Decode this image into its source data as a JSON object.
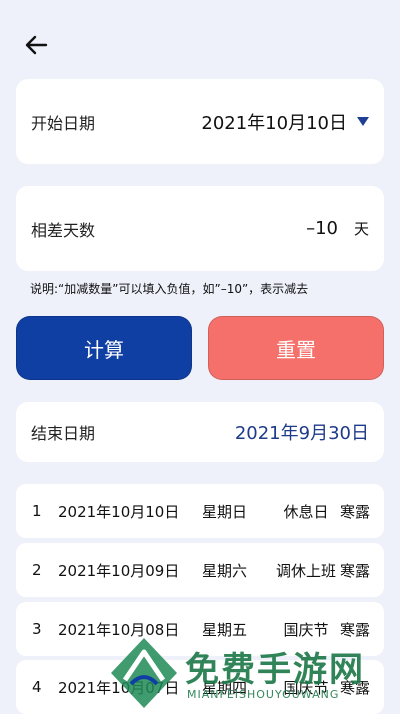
{
  "header": {
    "back_icon": "arrow-left-icon"
  },
  "start": {
    "label": "开始日期",
    "value": "2021年10月10日",
    "dropdown_icon": "triangle-down-icon"
  },
  "difference": {
    "label": "相差天数",
    "value": "–10",
    "unit": "天"
  },
  "note": "说明:“加减数量”可以填入负值，如”–10”，表示减去",
  "buttons": {
    "calculate": "计算",
    "reset": "重置"
  },
  "end": {
    "label": "结束日期",
    "value": "2021年9月30日"
  },
  "results": [
    {
      "index": "1",
      "date": "2021年10月10日",
      "weekday": "星期日",
      "type": "休息日",
      "term": "寒露"
    },
    {
      "index": "2",
      "date": "2021年10月09日",
      "weekday": "星期六",
      "type": "调休上班",
      "term": "寒露"
    },
    {
      "index": "3",
      "date": "2021年10月08日",
      "weekday": "星期五",
      "type": "国庆节",
      "term": "寒露"
    },
    {
      "index": "4",
      "date": "2021年10月07日",
      "weekday": "星期四",
      "type": "国庆节",
      "term": "寒露"
    }
  ],
  "watermark": {
    "title": "免费手游网",
    "subtitle": "MIANFEISHOUYOUWANG"
  },
  "colors": {
    "background": "#EEF0FA",
    "primary": "#0F3FA3",
    "reset": "#F5706A",
    "date_accent": "#1E3A8A"
  }
}
